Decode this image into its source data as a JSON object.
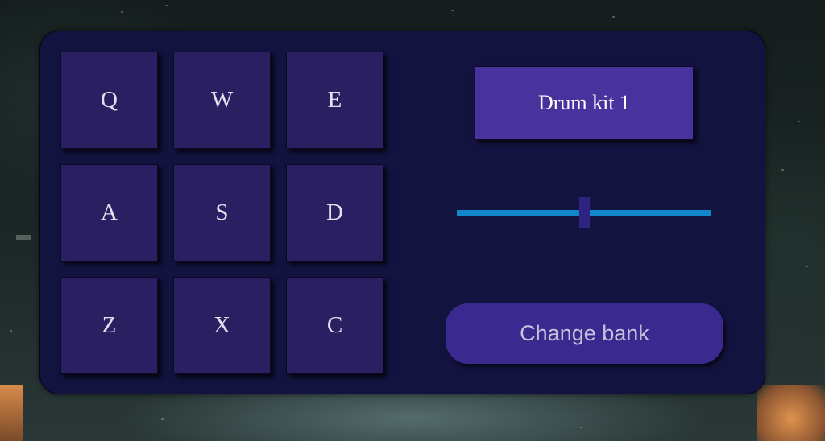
{
  "pads": [
    {
      "key": "Q"
    },
    {
      "key": "W"
    },
    {
      "key": "E"
    },
    {
      "key": "A"
    },
    {
      "key": "S"
    },
    {
      "key": "D"
    },
    {
      "key": "Z"
    },
    {
      "key": "X"
    },
    {
      "key": "C"
    }
  ],
  "display": {
    "text": "Drum kit 1"
  },
  "volume": {
    "level": 0.5
  },
  "bank_button": {
    "label": "Change bank"
  },
  "colors": {
    "panel": "#13133f",
    "pad": "#2a1f60",
    "display": "#48339e",
    "slider_track": "#0f87c8",
    "slider_thumb": "#2e2380",
    "button": "#3a2a8f"
  }
}
